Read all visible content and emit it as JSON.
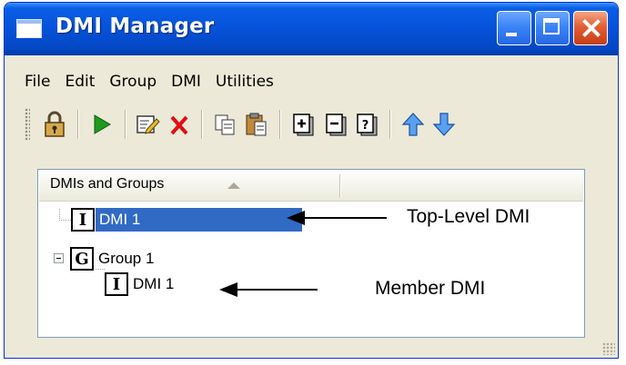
{
  "window": {
    "title": "DMI Manager"
  },
  "menu": [
    "File",
    "Edit",
    "Group",
    "DMI",
    "Utilities"
  ],
  "toolbar": {
    "icons": [
      "lock-icon",
      "run-icon",
      "edit-icon",
      "delete-icon",
      "copy-icon",
      "paste-icon",
      "add-item-icon",
      "remove-item-icon",
      "help-icon",
      "move-up-icon",
      "move-down-icon"
    ]
  },
  "tree": {
    "column_header": "DMIs and Groups",
    "nodes": [
      {
        "badge": "I",
        "label": "DMI 1",
        "selected": true,
        "type": "dmi"
      },
      {
        "badge": "G",
        "label": "Group 1",
        "expanded": true,
        "type": "group"
      },
      {
        "badge": "I",
        "label": "DMI 1",
        "type": "dmi"
      }
    ]
  },
  "annotations": {
    "top_level": "Top-Level DMI",
    "member": "Member DMI"
  },
  "colors": {
    "title_bar": "#0552d8",
    "selection": "#316ac5",
    "close_button": "#e35f34",
    "window_face": "#ece9d8"
  }
}
